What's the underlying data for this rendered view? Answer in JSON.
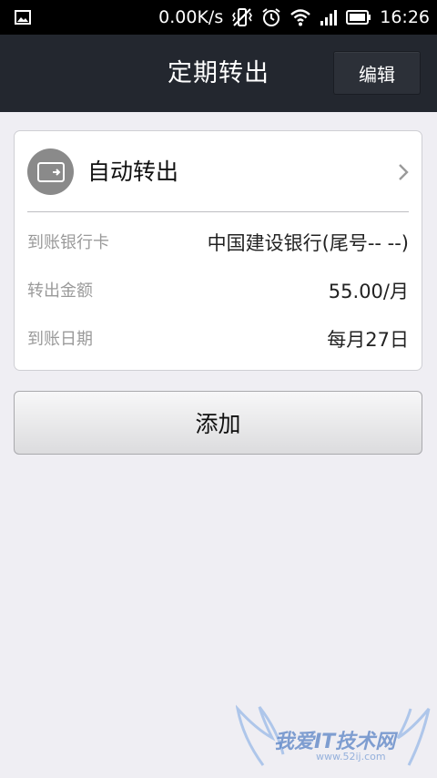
{
  "status_bar": {
    "speed": "0.00K/s",
    "time": "16:26"
  },
  "header": {
    "title": "定期转出",
    "edit_label": "编辑"
  },
  "card": {
    "title": "自动转出",
    "rows": [
      {
        "label": "到账银行卡",
        "value": "中国建设银行(尾号-- --)"
      },
      {
        "label": "转出金额",
        "value": "55.00/月"
      },
      {
        "label": "到账日期",
        "value": "每月27日"
      }
    ]
  },
  "add_button_label": "添加",
  "watermark": {
    "text": "我爱IT技术网",
    "url": "www.52ij.com"
  },
  "colors": {
    "title_bar": "#23272f",
    "background": "#efeef3",
    "icon_circle": "#8a8a8a"
  }
}
